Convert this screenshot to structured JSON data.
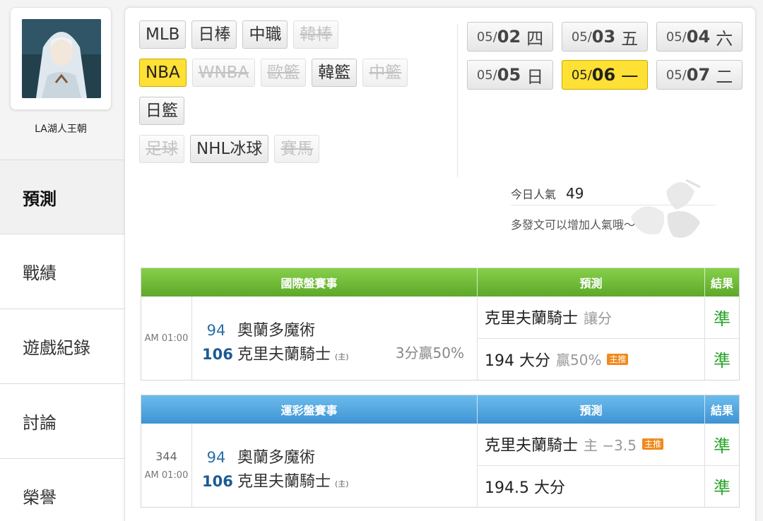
{
  "user": {
    "name": "LA湖人王朝"
  },
  "nav": [
    {
      "label": "預測",
      "active": true
    },
    {
      "label": "戰績",
      "active": false
    },
    {
      "label": "遊戲紀錄",
      "active": false
    },
    {
      "label": "討論",
      "active": false
    },
    {
      "label": "榮譽",
      "active": false
    }
  ],
  "leagues": {
    "row1": [
      {
        "label": "MLB",
        "state": "normal"
      },
      {
        "label": "日棒",
        "state": "normal"
      },
      {
        "label": "中職",
        "state": "normal"
      },
      {
        "label": "韓棒",
        "state": "disabled"
      }
    ],
    "row2": [
      {
        "label": "NBA",
        "state": "selected"
      },
      {
        "label": "WNBA",
        "state": "disabled"
      },
      {
        "label": "歐籃",
        "state": "disabled"
      },
      {
        "label": "韓籃",
        "state": "normal"
      },
      {
        "label": "中籃",
        "state": "disabled"
      }
    ],
    "row3": [
      {
        "label": "日籃",
        "state": "normal"
      }
    ],
    "row4": [
      {
        "label": "足球",
        "state": "disabled"
      },
      {
        "label": "NHL冰球",
        "state": "normal"
      },
      {
        "label": "賽馬",
        "state": "disabled"
      }
    ]
  },
  "dates": [
    {
      "month": "05/",
      "day": "02",
      "weekday": "四",
      "selected": false
    },
    {
      "month": "05/",
      "day": "03",
      "weekday": "五",
      "selected": false
    },
    {
      "month": "05/",
      "day": "04",
      "weekday": "六",
      "selected": false
    },
    {
      "month": "05/",
      "day": "05",
      "weekday": "日",
      "selected": false
    },
    {
      "month": "05/",
      "day": "06",
      "weekday": "一",
      "selected": true
    },
    {
      "month": "05/",
      "day": "07",
      "weekday": "二",
      "selected": false
    }
  ],
  "popularity": {
    "label": "今日人氣",
    "value": "49",
    "hint": "多發文可以增加人氣哦～"
  },
  "table_international": {
    "header": {
      "event": "國際盤賽事",
      "prediction": "預測",
      "result": "結果"
    },
    "time": "AM 01:00",
    "away": {
      "score": "94",
      "name": "奧蘭多魔術"
    },
    "home": {
      "score": "106",
      "name": "克里夫蘭騎士",
      "home_tag": "(主)"
    },
    "handicap": "3分贏50%",
    "predictions": [
      {
        "main": "克里夫蘭騎士",
        "sub": "讓分",
        "badge": ""
      },
      {
        "main": "194 大分",
        "sub": "贏50%",
        "badge": "主推"
      }
    ],
    "results": [
      "準",
      "準"
    ]
  },
  "table_lottery": {
    "header": {
      "event": "運彩盤賽事",
      "prediction": "預測",
      "result": "結果"
    },
    "game_no": "344",
    "time": "AM 01:00",
    "away": {
      "score": "94",
      "name": "奧蘭多魔術"
    },
    "home": {
      "score": "106",
      "name": "克里夫蘭騎士",
      "home_tag": "(主)"
    },
    "predictions": [
      {
        "main": "克里夫蘭騎士",
        "sub": "主 −3.5",
        "badge": "主推"
      },
      {
        "main": "194.5 大分",
        "sub": "",
        "badge": ""
      }
    ],
    "results": [
      "準",
      "準"
    ]
  },
  "colors": {
    "selected": "#ffe034",
    "green_header": "#6cbd38",
    "blue_header": "#4fa3de",
    "result_green": "#29a329",
    "badge_orange": "#f08a1d"
  }
}
